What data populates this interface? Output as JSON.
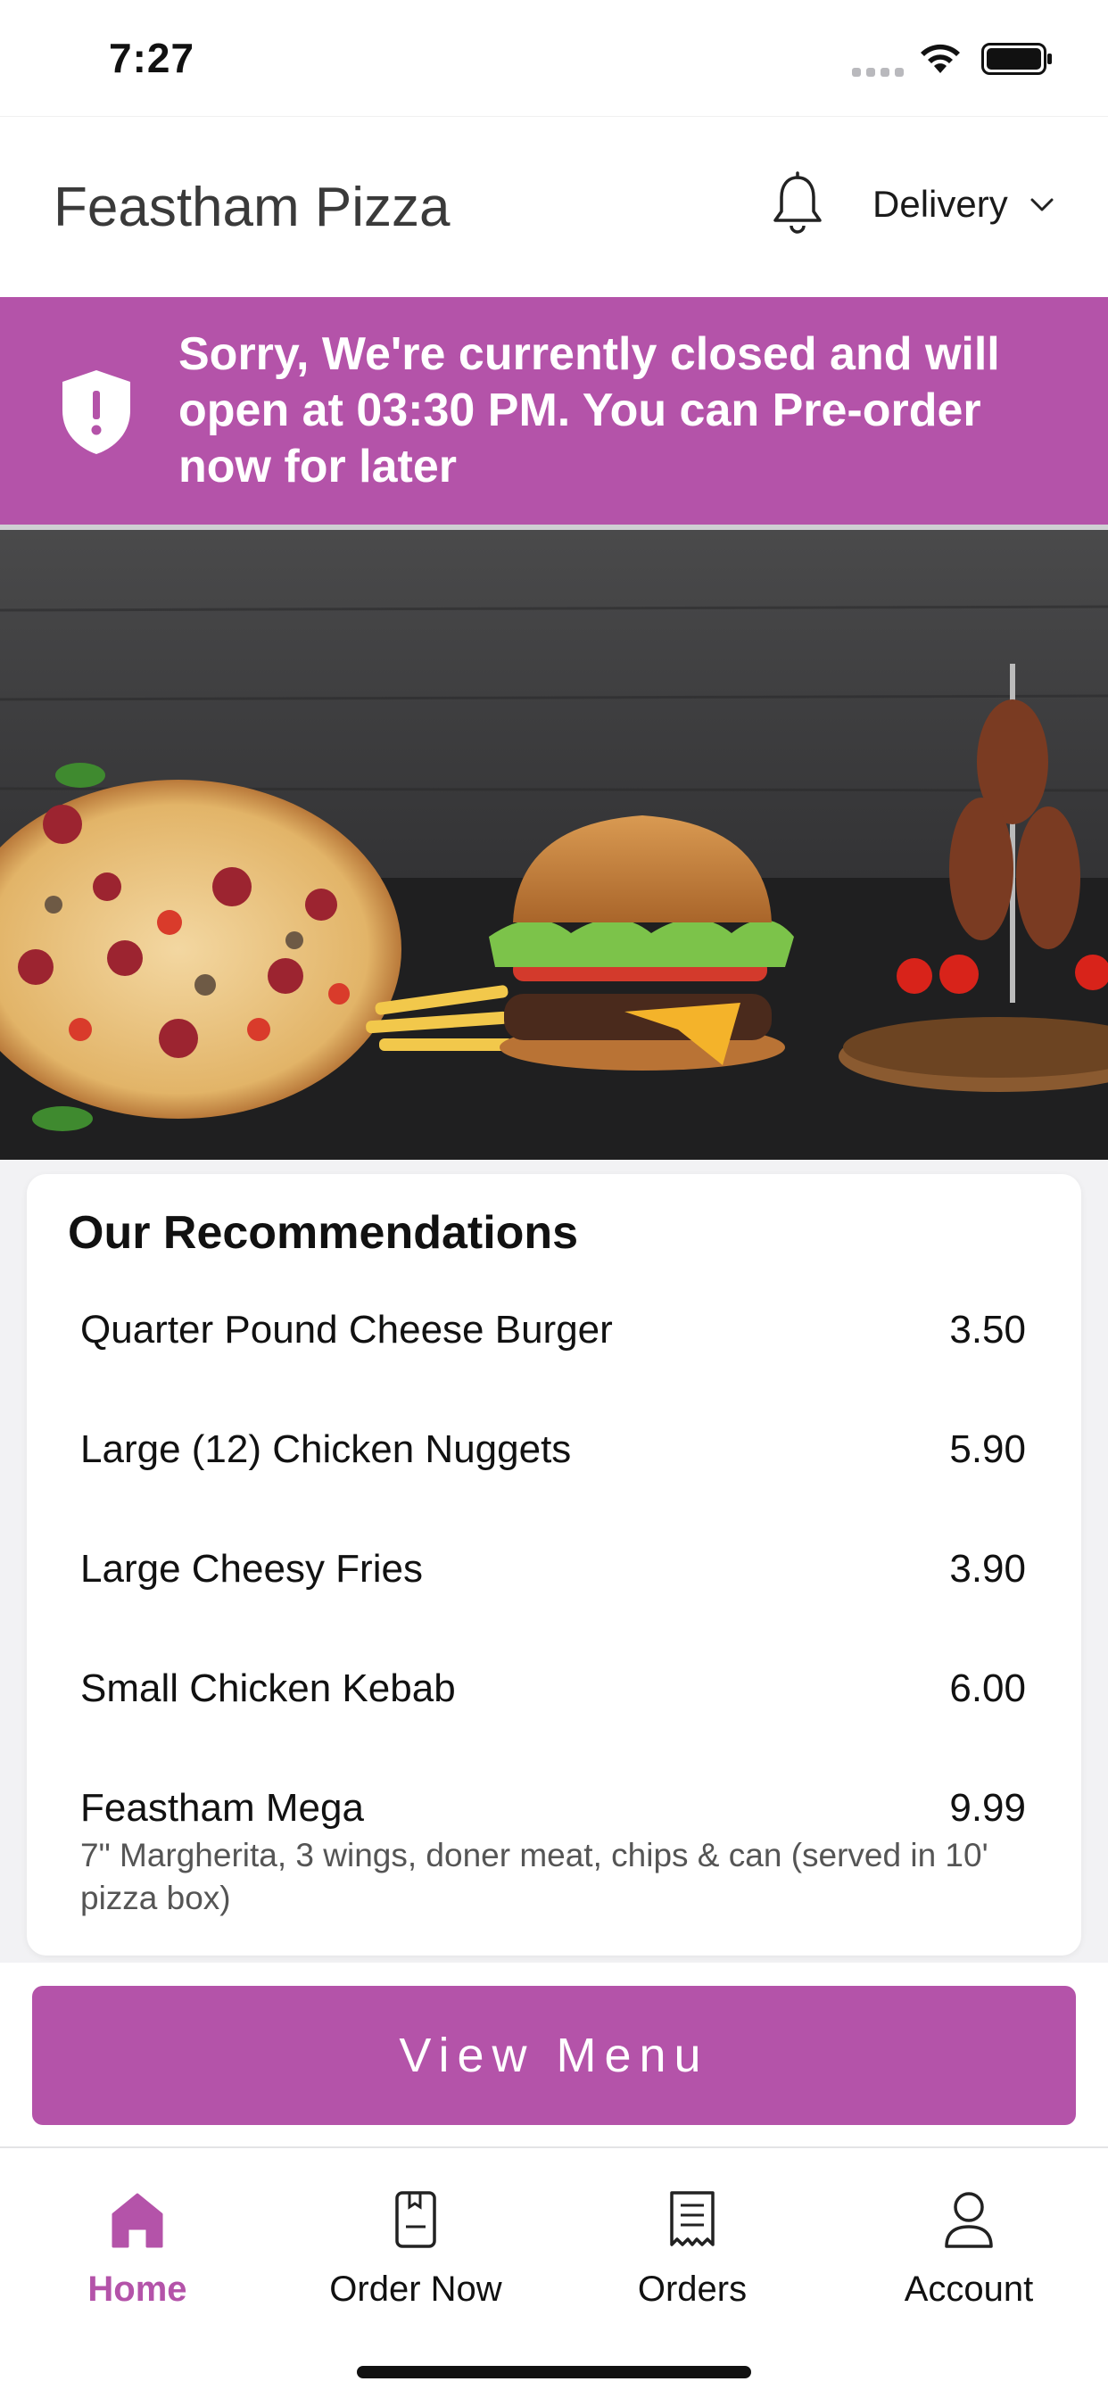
{
  "status_bar": {
    "time": "7:27",
    "icons": [
      "cellular-signal-icon",
      "wifi-icon",
      "battery-icon"
    ]
  },
  "header": {
    "title": "Feastham Pizza",
    "notification_icon": "bell-icon",
    "order_type": "Delivery",
    "order_type_icon": "chevron-down-icon"
  },
  "banner": {
    "icon": "shield-alert-icon",
    "message": "Sorry, We're currently closed and will open at 03:30 PM. You can Pre-order now for later",
    "background_color": "#b453a9"
  },
  "hero": {
    "image": "pizza-burger-kebab-photo"
  },
  "recommendations": {
    "title": "Our Recommendations",
    "items": [
      {
        "name": "Quarter Pound Cheese Burger",
        "price": "3.50",
        "description": ""
      },
      {
        "name": "Large (12) Chicken Nuggets",
        "price": "5.90",
        "description": ""
      },
      {
        "name": "Large Cheesy Fries",
        "price": "3.90",
        "description": ""
      },
      {
        "name": "Small Chicken Kebab",
        "price": "6.00",
        "description": ""
      },
      {
        "name": "Feastham Mega",
        "price": "9.99",
        "description": "7\" Margherita, 3 wings, doner meat, chips & can (served in 10' pizza box)"
      }
    ]
  },
  "view_menu": {
    "label": "View Menu"
  },
  "bottom_nav": {
    "accent_color": "#b453a9",
    "items": [
      {
        "label": "Home",
        "icon": "home-icon",
        "active": true
      },
      {
        "label": "Order Now",
        "icon": "menu-book-icon",
        "active": false
      },
      {
        "label": "Orders",
        "icon": "receipt-icon",
        "active": false
      },
      {
        "label": "Account",
        "icon": "user-icon",
        "active": false
      }
    ]
  }
}
